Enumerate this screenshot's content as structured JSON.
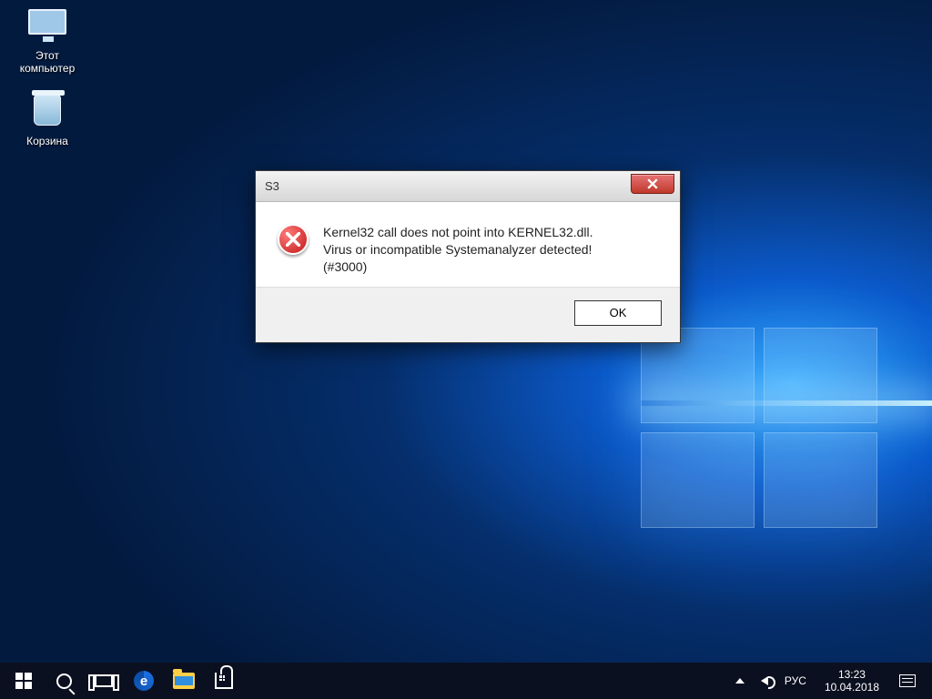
{
  "desktop": {
    "icons": [
      {
        "label": "Этот компьютер"
      },
      {
        "label": "Корзина"
      }
    ]
  },
  "dialog": {
    "title": "S3",
    "message_line1": "Kernel32 call does not point into KERNEL32.dll.",
    "message_line2": "Virus or incompatible Systemanalyzer detected!",
    "message_line3": "(#3000)",
    "ok_label": "OK"
  },
  "taskbar": {
    "tray": {
      "ime": "РУС",
      "time": "13:23",
      "date": "10.04.2018"
    }
  }
}
